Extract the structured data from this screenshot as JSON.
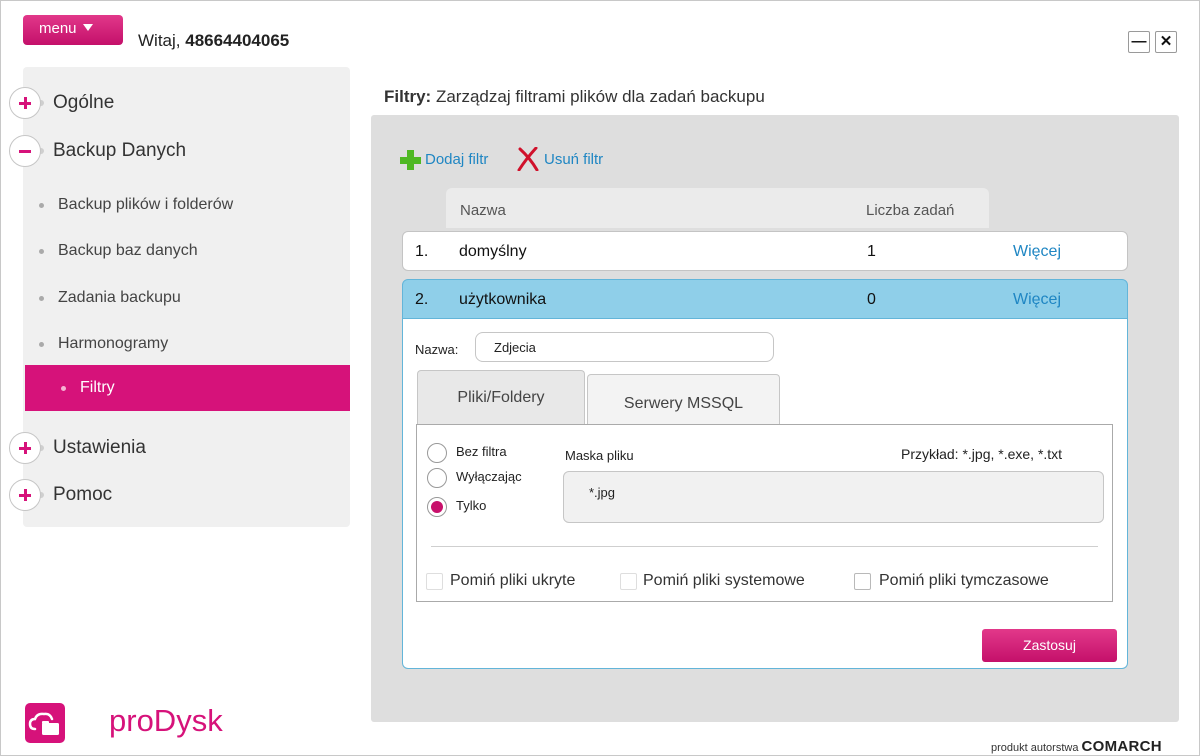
{
  "header": {
    "menu_label": "menu",
    "greeting_prefix": "Witaj,",
    "user_id": "48664404065",
    "minimize_glyph": "—",
    "close_glyph": "✕"
  },
  "sidebar": {
    "sections": [
      {
        "label": "Ogólne",
        "state": "collapsed"
      },
      {
        "label": "Backup Danych",
        "state": "expanded"
      },
      {
        "label": "Ustawienia",
        "state": "collapsed"
      },
      {
        "label": "Pomoc",
        "state": "collapsed"
      }
    ],
    "subitems": [
      {
        "label": "Backup plików i folderów"
      },
      {
        "label": "Backup baz danych"
      },
      {
        "label": "Zadania backupu"
      },
      {
        "label": "Harmonogramy"
      },
      {
        "label": "Filtry",
        "active": true
      }
    ]
  },
  "main": {
    "title_bold": "Filtry:",
    "title_text": "Zarządzaj filtrami plików dla zadań backupu",
    "toolbar": {
      "add_label": "Dodaj filtr",
      "remove_label": "Usuń filtr"
    },
    "table": {
      "columns": [
        "Nazwa",
        "Liczba zadań"
      ],
      "rows": [
        {
          "index": "1.",
          "name": "domyślny",
          "count": "1",
          "more": "Więcej",
          "selected": false
        },
        {
          "index": "2.",
          "name": "użytkownika",
          "count": "0",
          "more": "Więcej",
          "selected": true
        }
      ]
    },
    "detail": {
      "name_label": "Nazwa:",
      "name_value": "Zdjecia",
      "tabs": [
        {
          "label": "Pliki/Foldery",
          "active": true
        },
        {
          "label": "Serwery MSSQL",
          "active": false
        }
      ],
      "radios": [
        {
          "label": "Bez filtra",
          "checked": false
        },
        {
          "label": "Wyłączając",
          "checked": false
        },
        {
          "label": "Tylko",
          "checked": true
        }
      ],
      "mask_label": "Maska pliku",
      "example_label": "Przykład: *.jpg, *.exe, *.txt",
      "mask_value": "*.jpg",
      "checkboxes": [
        {
          "label": "Pomiń pliki ukryte",
          "checked": false,
          "enabled": false
        },
        {
          "label": "Pomiń pliki systemowe",
          "checked": false,
          "enabled": false
        },
        {
          "label": "Pomiń pliki tymczasowe",
          "checked": false,
          "enabled": true
        }
      ],
      "apply_label": "Zastosuj"
    }
  },
  "branding": {
    "app_name": "proDysk",
    "footer_prefix": "produkt autorstwa",
    "footer_brand": "COMARCH"
  },
  "colors": {
    "accent": "#d6127a",
    "link": "#1f86c3",
    "selected_row": "#8fcfe9",
    "add_icon": "#4fb823",
    "remove_icon": "#d0112b"
  },
  "icons": {
    "menu": "chevron-down-icon",
    "section_collapsed": "plus-circle-icon",
    "section_expanded": "minus-circle-icon",
    "add": "plus-icon",
    "remove": "x-icon",
    "logo": "cloud-folder-icon"
  }
}
